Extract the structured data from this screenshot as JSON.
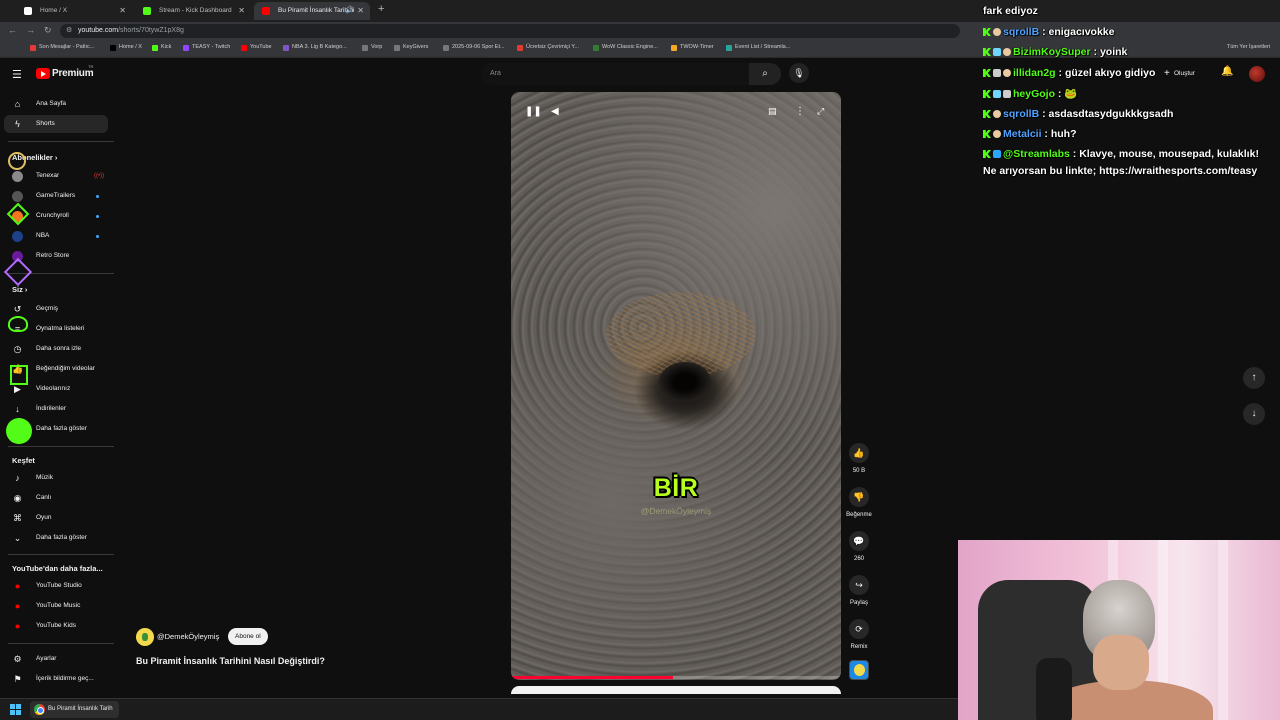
{
  "browser": {
    "tabs": [
      {
        "title": "Home / X",
        "favicon_color": "#000000"
      },
      {
        "title": "Stream - Kick Dashboard",
        "favicon_color": "#53fc18"
      },
      {
        "title": "Bu Piramit İnsanlık Tarihini",
        "favicon_color": "#ff0000"
      }
    ],
    "url_main": "youtube.com",
    "url_path": "/shorts/70tywZ1pX8g",
    "bookmarks": [
      {
        "label": "Son Mesajlar - Patlıc...",
        "color": "#e53935"
      },
      {
        "label": "Home / X",
        "color": "#000000"
      },
      {
        "label": "Kick",
        "color": "#53fc18"
      },
      {
        "label": "TEASY - Twitch",
        "color": "#9146ff"
      },
      {
        "label": "YouTube",
        "color": "#ff0000"
      },
      {
        "label": "NBA 3. Lig B Katego...",
        "color": "#7e57c2"
      },
      {
        "label": "Vorp",
        "color": "#777777"
      },
      {
        "label": "KeyGivers",
        "color": "#777777"
      },
      {
        "label": "2025-09-06 Spor Et...",
        "color": "#777777"
      },
      {
        "label": "Ücretsiz Çevrimiçi Y...",
        "color": "#e53935"
      },
      {
        "label": "WoW Classic Engine...",
        "color": "#2e7d32"
      },
      {
        "label": "TWOW-Timer",
        "color": "#f9a825"
      },
      {
        "label": "Event List / Streamla...",
        "color": "#26a69a"
      }
    ],
    "all_bookmarks": "Tüm Yer İşaretleri"
  },
  "youtube": {
    "logo_text": "Premium",
    "logo_region": "TR",
    "search_placeholder": "Ara",
    "create_label": "Oluştur",
    "sidebar": {
      "main": [
        {
          "label": "Ana Sayfa",
          "icon": "home-icon"
        },
        {
          "label": "Shorts",
          "icon": "shorts-icon"
        }
      ],
      "subs_header": "Abonelikler",
      "subs": [
        {
          "label": "Tenexar",
          "color": "#8a8a8a",
          "live": true
        },
        {
          "label": "GameTrailers",
          "color": "#555555",
          "dot": true
        },
        {
          "label": "Crunchyroll",
          "color": "#f47521",
          "dot": true
        },
        {
          "label": "NBA",
          "color": "#1d428a",
          "dot": true
        },
        {
          "label": "Retro Store",
          "color": "#6a1b9a",
          "dot": false
        }
      ],
      "you_header": "Siz",
      "you": [
        {
          "label": "Geçmiş",
          "icon": "history-icon",
          "glyph": "↺"
        },
        {
          "label": "Oynatma listeleri",
          "icon": "playlist-icon",
          "glyph": "≡"
        },
        {
          "label": "Daha sonra izle",
          "icon": "clock-icon",
          "glyph": "◷"
        },
        {
          "label": "Beğendiğim videolar",
          "icon": "thumbs-up-icon",
          "glyph": "👍"
        },
        {
          "label": "Videolarınız",
          "icon": "video-icon",
          "glyph": "▶"
        },
        {
          "label": "İndirilenler",
          "icon": "download-icon",
          "glyph": "↓"
        },
        {
          "label": "Daha fazla göster",
          "icon": "chevron-down-icon",
          "glyph": "⌄"
        }
      ],
      "explore_header": "Keşfet",
      "explore": [
        {
          "label": "Müzik",
          "icon": "music-icon",
          "glyph": "♪"
        },
        {
          "label": "Canlı",
          "icon": "live-icon",
          "glyph": "◉"
        },
        {
          "label": "Oyun",
          "icon": "gamepad-icon",
          "glyph": "⌘"
        },
        {
          "label": "Daha fazla göster",
          "icon": "chevron-down-icon",
          "glyph": "⌄"
        }
      ],
      "more_header": "YouTube'dan daha fazla...",
      "more": [
        {
          "label": "YouTube Studio",
          "color": "#ff0000"
        },
        {
          "label": "YouTube Music",
          "color": "#ff0000"
        },
        {
          "label": "YouTube Kids",
          "color": "#ff0000"
        }
      ],
      "bottom": [
        {
          "label": "Ayarlar",
          "icon": "gear-icon",
          "glyph": "⚙"
        },
        {
          "label": "İçerik bildirme geç...",
          "icon": "flag-icon",
          "glyph": "⚑"
        }
      ]
    },
    "short": {
      "caption": "BİR",
      "watermark": "@DemekÖyleymiş",
      "progress_fraction": 0.49,
      "channel": "@DemekÖyleymiş",
      "subscribe_label": "Abone ol",
      "title": "Bu Piramit İnsanlık Tarihini Nasıl Değiştirdi?",
      "actions": [
        {
          "label": "50 B",
          "icon": "like-icon",
          "glyph": "👍"
        },
        {
          "label": "Beğenme",
          "icon": "dislike-icon",
          "glyph": "👎"
        },
        {
          "label": "260",
          "icon": "comment-icon",
          "glyph": "💬"
        },
        {
          "label": "Paylaş",
          "icon": "share-icon",
          "glyph": "↪"
        },
        {
          "label": "Remix",
          "icon": "remix-icon",
          "glyph": "⟳"
        }
      ]
    }
  },
  "chat": {
    "top_fragment": "fark ediyoz",
    "messages": [
      {
        "user": "sqrollB",
        "user_color": "#4fa3ff",
        "text": "enigacıvokke",
        "badges": [
          "kick",
          "face"
        ]
      },
      {
        "user": "BizimKoySuper",
        "user_color": "#53fc18",
        "text": "yoink",
        "badges": [
          "kick",
          "badge",
          "face"
        ]
      },
      {
        "user": "illidan2g",
        "user_color": "#53fc18",
        "text": "güzel akıyo gidiyo",
        "badges": [
          "kick",
          "badge2",
          "face"
        ]
      },
      {
        "user": "heyGojo",
        "user_color": "#53fc18",
        "text": "🐸",
        "badges": [
          "kick",
          "badge",
          "badge2"
        ]
      },
      {
        "user": "sqrollB",
        "user_color": "#4fa3ff",
        "text": "asdasdtasydgukkkgsadh",
        "badges": [
          "kick",
          "face"
        ]
      },
      {
        "user": "Metalcii",
        "user_color": "#4fa3ff",
        "text": "huh?",
        "badges": [
          "kick",
          "face"
        ]
      },
      {
        "user": "@Streamlabs",
        "user_color": "#53fc18",
        "text": "Klavye, mouse, mousepad, kulaklık!",
        "badges": [
          "kick",
          "tw"
        ]
      }
    ],
    "continuation": "Ne arıyorsan bu linkte; https://wraithesports.com/teasy"
  },
  "taskbar": {
    "app_label": "Bu Piramit İnsanlık Tarih"
  }
}
